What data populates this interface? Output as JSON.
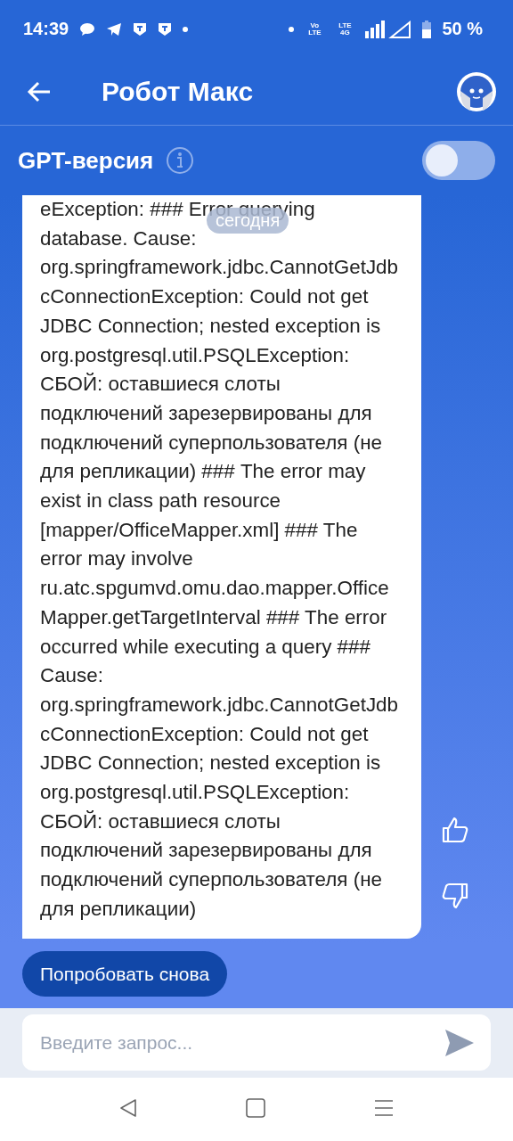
{
  "status_bar": {
    "time": "14:39",
    "volte_label": "Vo LTE",
    "network_label": "LTE 4G",
    "battery": "50 %"
  },
  "header": {
    "title": "Робот Макс"
  },
  "gpt": {
    "label": "GPT-версия",
    "on": false
  },
  "date_chip": "сегодня",
  "message": {
    "text": "eException: ### Error querying database. Cause: org.springframework.jdbc.CannotGetJdbcConnectionException: Could not get JDBC Connection; nested exception is org.postgresql.util.PSQLException: СБОЙ: оставшиеся слоты подключений зарезервированы для подключений суперпользователя (не для репликации) ### The error may exist in class path resource [mapper/OfficeMapper.xml] ### The error may involve ru.atc.spgumvd.omu.dao.mapper.OfficeMapper.getTargetInterval ### The error occurred while executing a query ### Cause: org.springframework.jdbc.CannotGetJdbcConnectionException: Could not get JDBC Connection; nested exception is org.postgresql.util.PSQLException: СБОЙ: оставшиеся слоты подключений зарезервированы для подключений суперпользователя (не для репликации)"
  },
  "retry_button": "Попробовать снова",
  "input": {
    "placeholder": "Введите запрос..."
  }
}
